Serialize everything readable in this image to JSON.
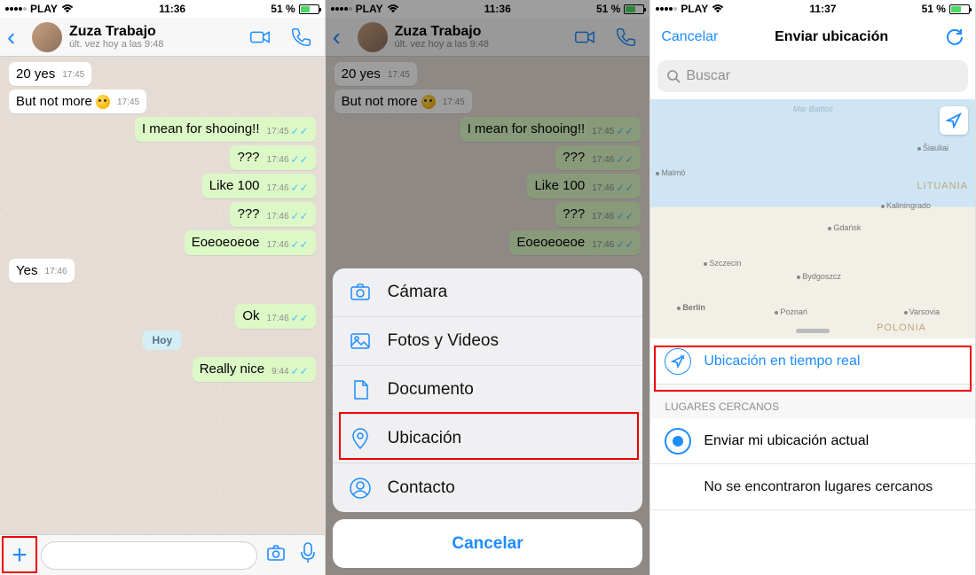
{
  "status": {
    "carrier": "PLAY",
    "time1": "11:36",
    "time2": "11:36",
    "time3": "11:37",
    "battery": "51 %"
  },
  "chat": {
    "name": "Zuza Trabajo",
    "sub": "últ. vez hoy a las 9:48",
    "msgs": [
      {
        "t": "20 yes",
        "time": "17:45",
        "dir": "in"
      },
      {
        "t": "But not more ",
        "emoji": true,
        "time": "17:45",
        "dir": "in"
      },
      {
        "t": "I mean for shooing!!",
        "time": "17:45",
        "dir": "out"
      },
      {
        "t": "???",
        "time": "17:46",
        "dir": "out"
      },
      {
        "t": "Like 100",
        "time": "17:46",
        "dir": "out"
      },
      {
        "t": "???",
        "time": "17:46",
        "dir": "out"
      },
      {
        "t": "Eoeoeoeoe",
        "time": "17:46",
        "dir": "out"
      },
      {
        "t": "Yes",
        "time": "17:46",
        "dir": "in"
      }
    ],
    "msgs2": [
      {
        "t": "Ok",
        "time": "17:46",
        "dir": "out"
      }
    ],
    "date": "Hoy",
    "msgs3": [
      {
        "t": "Really nice",
        "time": "9:44",
        "dir": "out"
      }
    ]
  },
  "sheet": {
    "camera": "Cámara",
    "photos": "Fotos y Videos",
    "document": "Documento",
    "location": "Ubicación",
    "contact": "Contacto",
    "cancel": "Cancelar"
  },
  "loc": {
    "cancel": "Cancelar",
    "title": "Enviar ubicación",
    "search": "Buscar",
    "live": "Ubicación en tiempo real",
    "section": "LUGARES CERCANOS",
    "current": "Enviar mi ubicación actual",
    "none": "No se encontraron lugares cercanos",
    "sea": "Mar Baltico",
    "cities": {
      "malmo": "Malmö",
      "siauliai": "Šiauliai",
      "kalin": "Kaliningrado",
      "gdansk": "Gdańsk",
      "szcz": "Szczecin",
      "bydg": "Bydgoszcz",
      "berlin": "Berlín",
      "poznan": "Poznań",
      "varsovia": "Varsovia"
    },
    "countries": {
      "lit": "LITUANIA",
      "pol": "POLONIA"
    }
  }
}
